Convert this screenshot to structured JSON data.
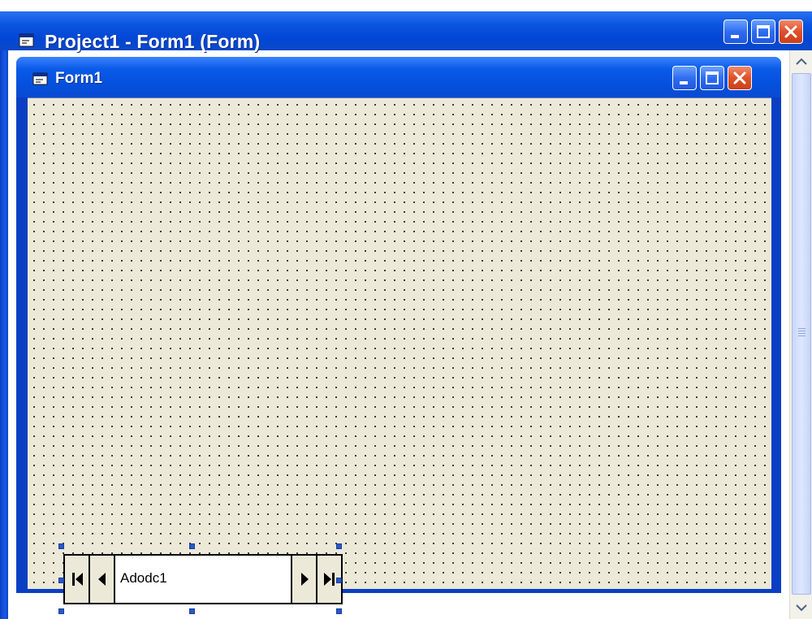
{
  "outer_window": {
    "title": "Project1 - Form1 (Form)",
    "icon": "form-icon",
    "caption_buttons": [
      "minimize-icon",
      "maximize-icon",
      "close-icon"
    ]
  },
  "form_window": {
    "title": "Form1",
    "icon": "form-icon",
    "caption_buttons": [
      "minimize-icon",
      "maximize-icon",
      "close-icon"
    ],
    "background_color": "#ece9d8",
    "grid_dot_color": "#111111"
  },
  "adodc_control": {
    "caption": "Adodc1",
    "buttons": [
      "move-first-icon",
      "move-previous-icon",
      "move-next-icon",
      "move-last-icon"
    ],
    "selected": true
  },
  "colors": {
    "titlebar_blue": "#0450dc",
    "close_button_red": "#e0502a",
    "selection_handle": "#2a57c8"
  }
}
